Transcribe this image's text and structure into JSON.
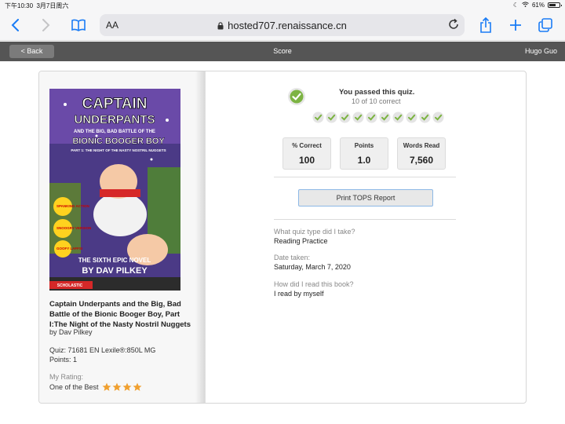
{
  "status_bar": {
    "time": "下午10:30",
    "date": "3月7日周六",
    "battery": "61%"
  },
  "browser": {
    "aa_label": "AA",
    "url": "hosted707.renaissance.cn",
    "icons": [
      "back-icon",
      "forward-icon",
      "bookmarks-icon",
      "lock-icon",
      "reload-icon",
      "share-icon",
      "new-tab-icon",
      "tabs-icon"
    ]
  },
  "appbar": {
    "back_label": "< Back",
    "title": "Score",
    "user": "Hugo Guo",
    "bg_color": "#555555"
  },
  "book": {
    "title": "Captain Underpants and the Big, Bad Battle of the Bionic Booger Boy, Part I:The Night of the Nasty Nostril Nuggets",
    "author": "by Dav Pilkey",
    "quiz_line": "Quiz: 71681  EN   Lexile®:850L  MG",
    "points_line": "Points: 1",
    "rating_label": "My Rating:",
    "rating_value": "One of the Best",
    "rating_stars": 4,
    "cover": {
      "line1": "CAPTAIN",
      "line2": "UNDERPANTS",
      "line3": "AND THE BIG, BAD BATTLE OF THE",
      "line4": "BIONIC BOOGER BOY",
      "line5": "PART 1: THE NIGHT OF THE NASTY NOSTRIL NUGGETS",
      "line6": "THE SIXTH EPIC NOVEL",
      "line7": "BY DAV PILKEY",
      "badge1": "SPANKING ACTION",
      "badge2": "SNOOGRY VERSION",
      "badge3": "GOOFY LAFFS!",
      "publisher": "SCHOLASTIC"
    }
  },
  "result": {
    "title": "You passed this quiz.",
    "subtitle": "10 of 10 correct",
    "correct_count": 10,
    "accent_color": "#7cb342"
  },
  "stats": [
    {
      "label": "% Correct",
      "value": "100"
    },
    {
      "label": "Points",
      "value": "1.0"
    },
    {
      "label": "Words Read",
      "value": "7,560"
    }
  ],
  "tops_button": "Print TOPS Report",
  "details": [
    {
      "question": "What quiz type did I take?",
      "answer": "Reading Practice"
    },
    {
      "question": "Date taken:",
      "answer": "Saturday, March 7, 2020"
    },
    {
      "question": "How did I read this book?",
      "answer": "I read by myself"
    }
  ]
}
